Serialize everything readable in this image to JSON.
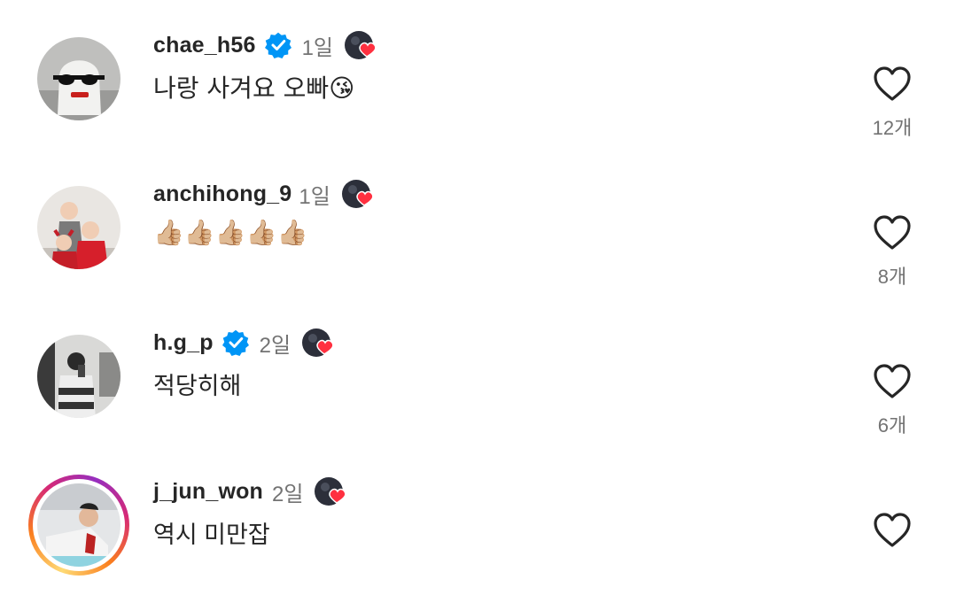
{
  "comments": [
    {
      "username": "chae_h56",
      "verified": true,
      "time": "1일",
      "text": "나랑 사겨요 오빠😘",
      "likes": "12개"
    },
    {
      "username": "anchihong_9",
      "verified": false,
      "time": "1일",
      "text": "👍🏼👍🏼👍🏼👍🏼👍🏼",
      "likes": "8개"
    },
    {
      "username": "h.g_p",
      "verified": true,
      "time": "2일",
      "text": "적당히해",
      "likes": "6개"
    },
    {
      "username": "j_jun_won",
      "verified": false,
      "time": "2일",
      "text": "역시 미만잡",
      "likes": ""
    }
  ],
  "colors": {
    "verified": "#0095f6",
    "heart": "#ff3040",
    "text": "#262626",
    "secondary": "#737373"
  },
  "icons": {
    "like": "heart-outline-icon",
    "verified": "verified-badge-icon",
    "creator_liked": "creator-liked-heart-icon"
  }
}
